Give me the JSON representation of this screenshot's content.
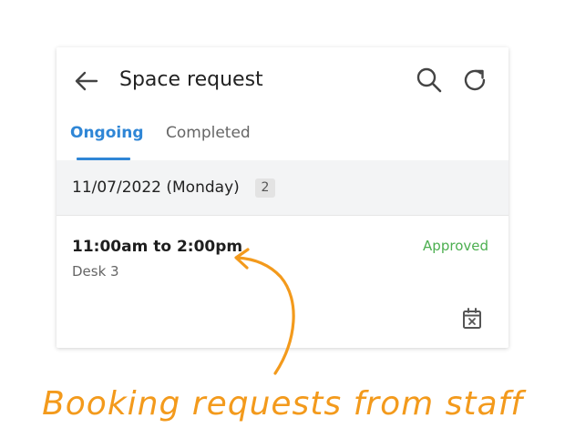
{
  "header": {
    "title": "Space request",
    "back_icon": "arrow-left-icon",
    "search_icon": "search-icon",
    "refresh_icon": "refresh-icon"
  },
  "tabs": [
    {
      "label": "Ongoing",
      "active": true
    },
    {
      "label": "Completed",
      "active": false
    }
  ],
  "group": {
    "date": "11/07/2022 (Monday)",
    "count": "2"
  },
  "requests": [
    {
      "time": "11:00am to 2:00pm",
      "status": "Approved",
      "resource": "Desk 3",
      "action_icon": "calendar-cancel-icon"
    }
  ],
  "annotation": {
    "caption": "Booking requests from staff"
  },
  "colors": {
    "accent": "#2f86d6",
    "approved": "#4caf50",
    "annotation": "#f39a1c"
  }
}
